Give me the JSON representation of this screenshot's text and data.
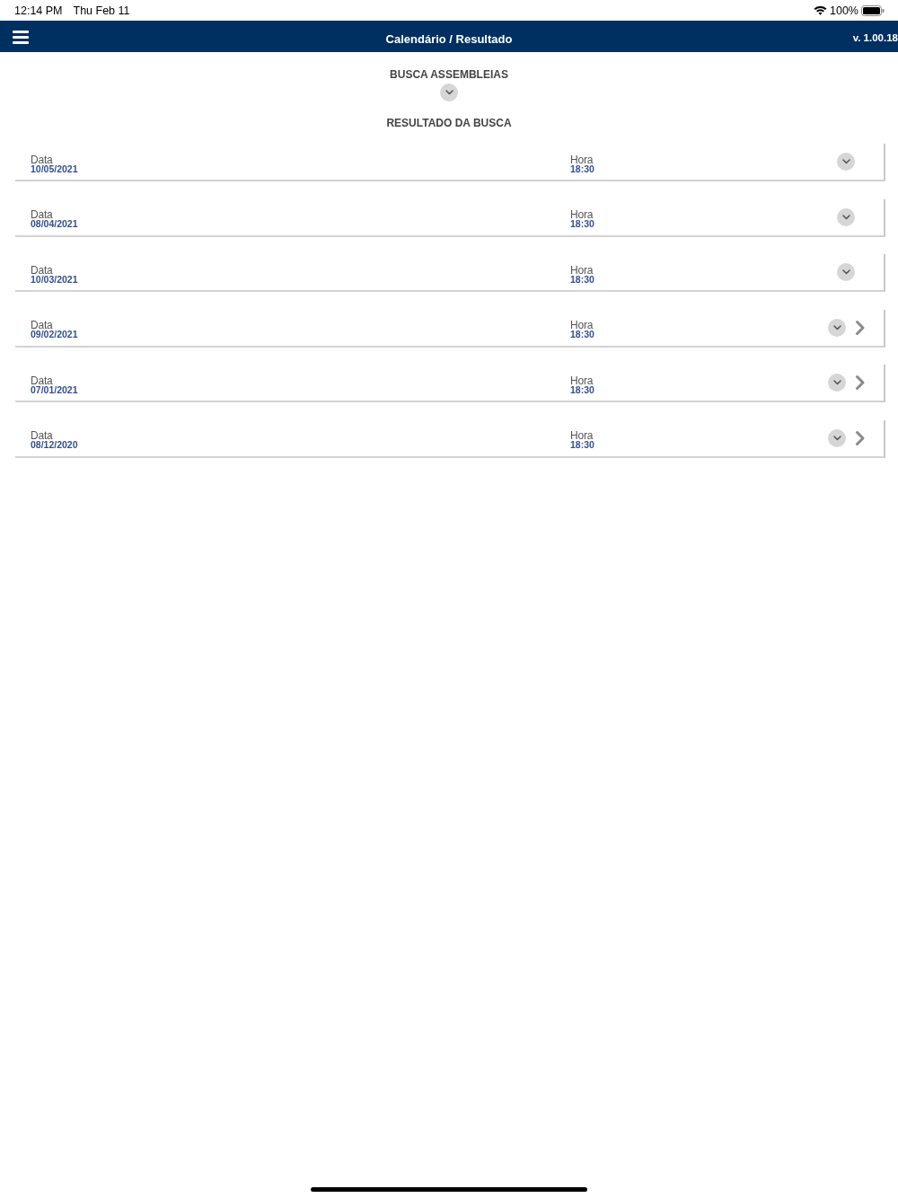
{
  "status_bar": {
    "time": "12:14 PM",
    "date": "Thu Feb 11",
    "battery": "100%"
  },
  "header": {
    "title": "Calendário / Resultado",
    "version": "v. 1.00.18"
  },
  "search": {
    "title": "BUSCA ASSEMBLEIAS",
    "expanded": false
  },
  "results": {
    "title": "RESULTADO DA BUSCA",
    "items": [
      {
        "date_label": "Data",
        "date": "10/05/2021",
        "time_label": "Hora",
        "time": "18:30",
        "expanded": false,
        "navigable": false
      },
      {
        "date_label": "Data",
        "date": "08/04/2021",
        "time_label": "Hora",
        "time": "18:30",
        "expanded": false,
        "navigable": false
      },
      {
        "date_label": "Data",
        "date": "10/03/2021",
        "time_label": "Hora",
        "time": "18:30",
        "expanded": false,
        "navigable": false
      },
      {
        "date_label": "Data",
        "date": "09/02/2021",
        "time_label": "Hora",
        "time": "18:30",
        "expanded": false,
        "navigable": true
      },
      {
        "date_label": "Data",
        "date": "07/01/2021",
        "time_label": "Hora",
        "time": "18:30",
        "expanded": false,
        "navigable": true
      },
      {
        "date_label": "Data",
        "date": "08/12/2020",
        "time_label": "Hora",
        "time": "18:30",
        "expanded": false,
        "navigable": true
      }
    ]
  }
}
